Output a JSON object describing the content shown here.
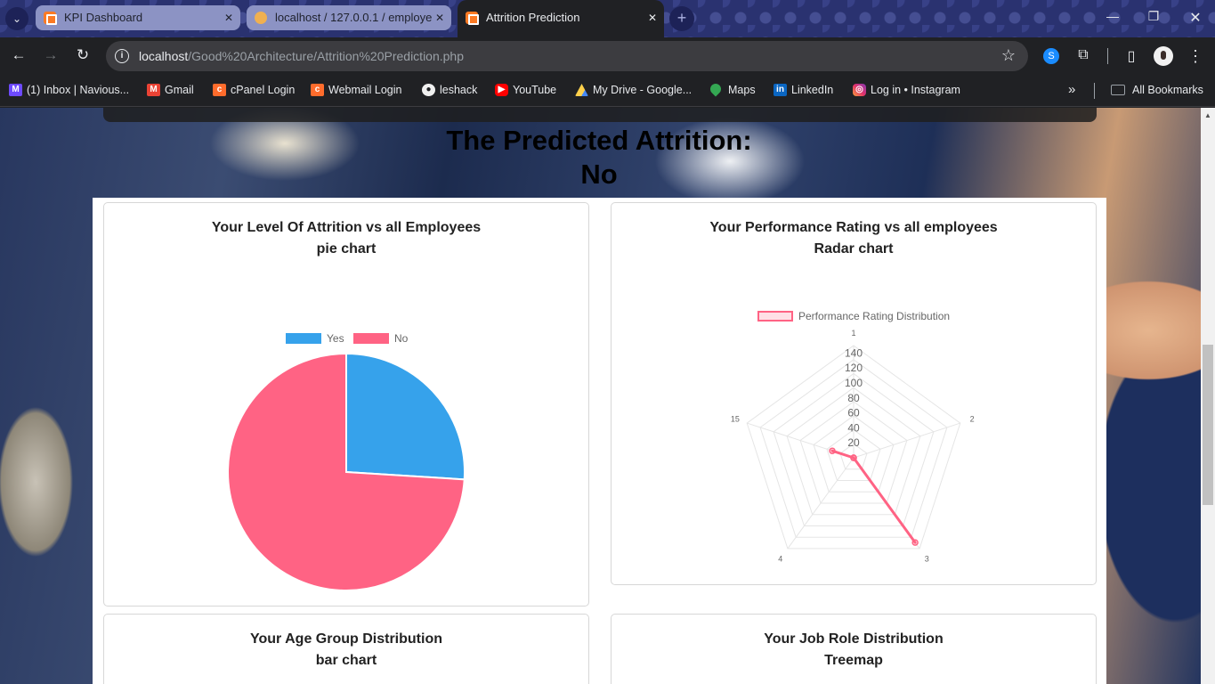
{
  "browser": {
    "tabs": [
      {
        "title": "KPI Dashboard",
        "active": false
      },
      {
        "title": "localhost / 127.0.0.1 / employe",
        "active": false
      },
      {
        "title": "Attrition Prediction",
        "active": true
      }
    ],
    "url_host": "localhost",
    "url_path": "/Good%20Architecture/Attrition%20Prediction.php",
    "bookmarks": [
      {
        "label": "(1) Inbox | Navious...",
        "icon": "proton-mail-icon"
      },
      {
        "label": "Gmail",
        "icon": "gmail-icon"
      },
      {
        "label": "cPanel Login",
        "icon": "cpanel-icon"
      },
      {
        "label": "Webmail Login",
        "icon": "cpanel-icon"
      },
      {
        "label": "leshack",
        "icon": "github-icon"
      },
      {
        "label": "YouTube",
        "icon": "youtube-icon"
      },
      {
        "label": "My Drive - Google...",
        "icon": "google-drive-icon"
      },
      {
        "label": "Maps",
        "icon": "maps-icon"
      },
      {
        "label": "LinkedIn",
        "icon": "linkedin-icon"
      },
      {
        "label": "Log in • Instagram",
        "icon": "instagram-icon"
      }
    ],
    "all_bookmarks": "All Bookmarks"
  },
  "page": {
    "result_label": "The Predicted Attrition:",
    "result_value": "No",
    "cards": {
      "attrition": {
        "title": "Your Level Of Attrition vs all Employees",
        "subtitle": "pie chart"
      },
      "performance": {
        "title": "Your Performance Rating vs all employees",
        "subtitle": "Radar chart"
      },
      "age": {
        "title": "Your Age Group Distribution",
        "subtitle": "bar chart"
      },
      "jobrole": {
        "title": "Your Job Role Distribution",
        "subtitle": "Treemap"
      }
    }
  },
  "chart_data": [
    {
      "type": "pie",
      "labels": [
        "Yes",
        "No"
      ],
      "values": [
        26,
        74
      ],
      "colors": [
        "#36a2eb",
        "#ff6384"
      ],
      "legend": "top"
    },
    {
      "type": "radar",
      "labels": [
        "1",
        "2",
        "3",
        "4",
        "15"
      ],
      "series": [
        {
          "name": "Performance Rating Distribution",
          "values": [
            0,
            0,
            140,
            0,
            30
          ],
          "color": "#ff6384"
        }
      ],
      "ticks": [
        "20",
        "40",
        "60",
        "80",
        "100",
        "120",
        "140"
      ],
      "range": [
        0,
        150
      ],
      "legend": "top"
    }
  ]
}
